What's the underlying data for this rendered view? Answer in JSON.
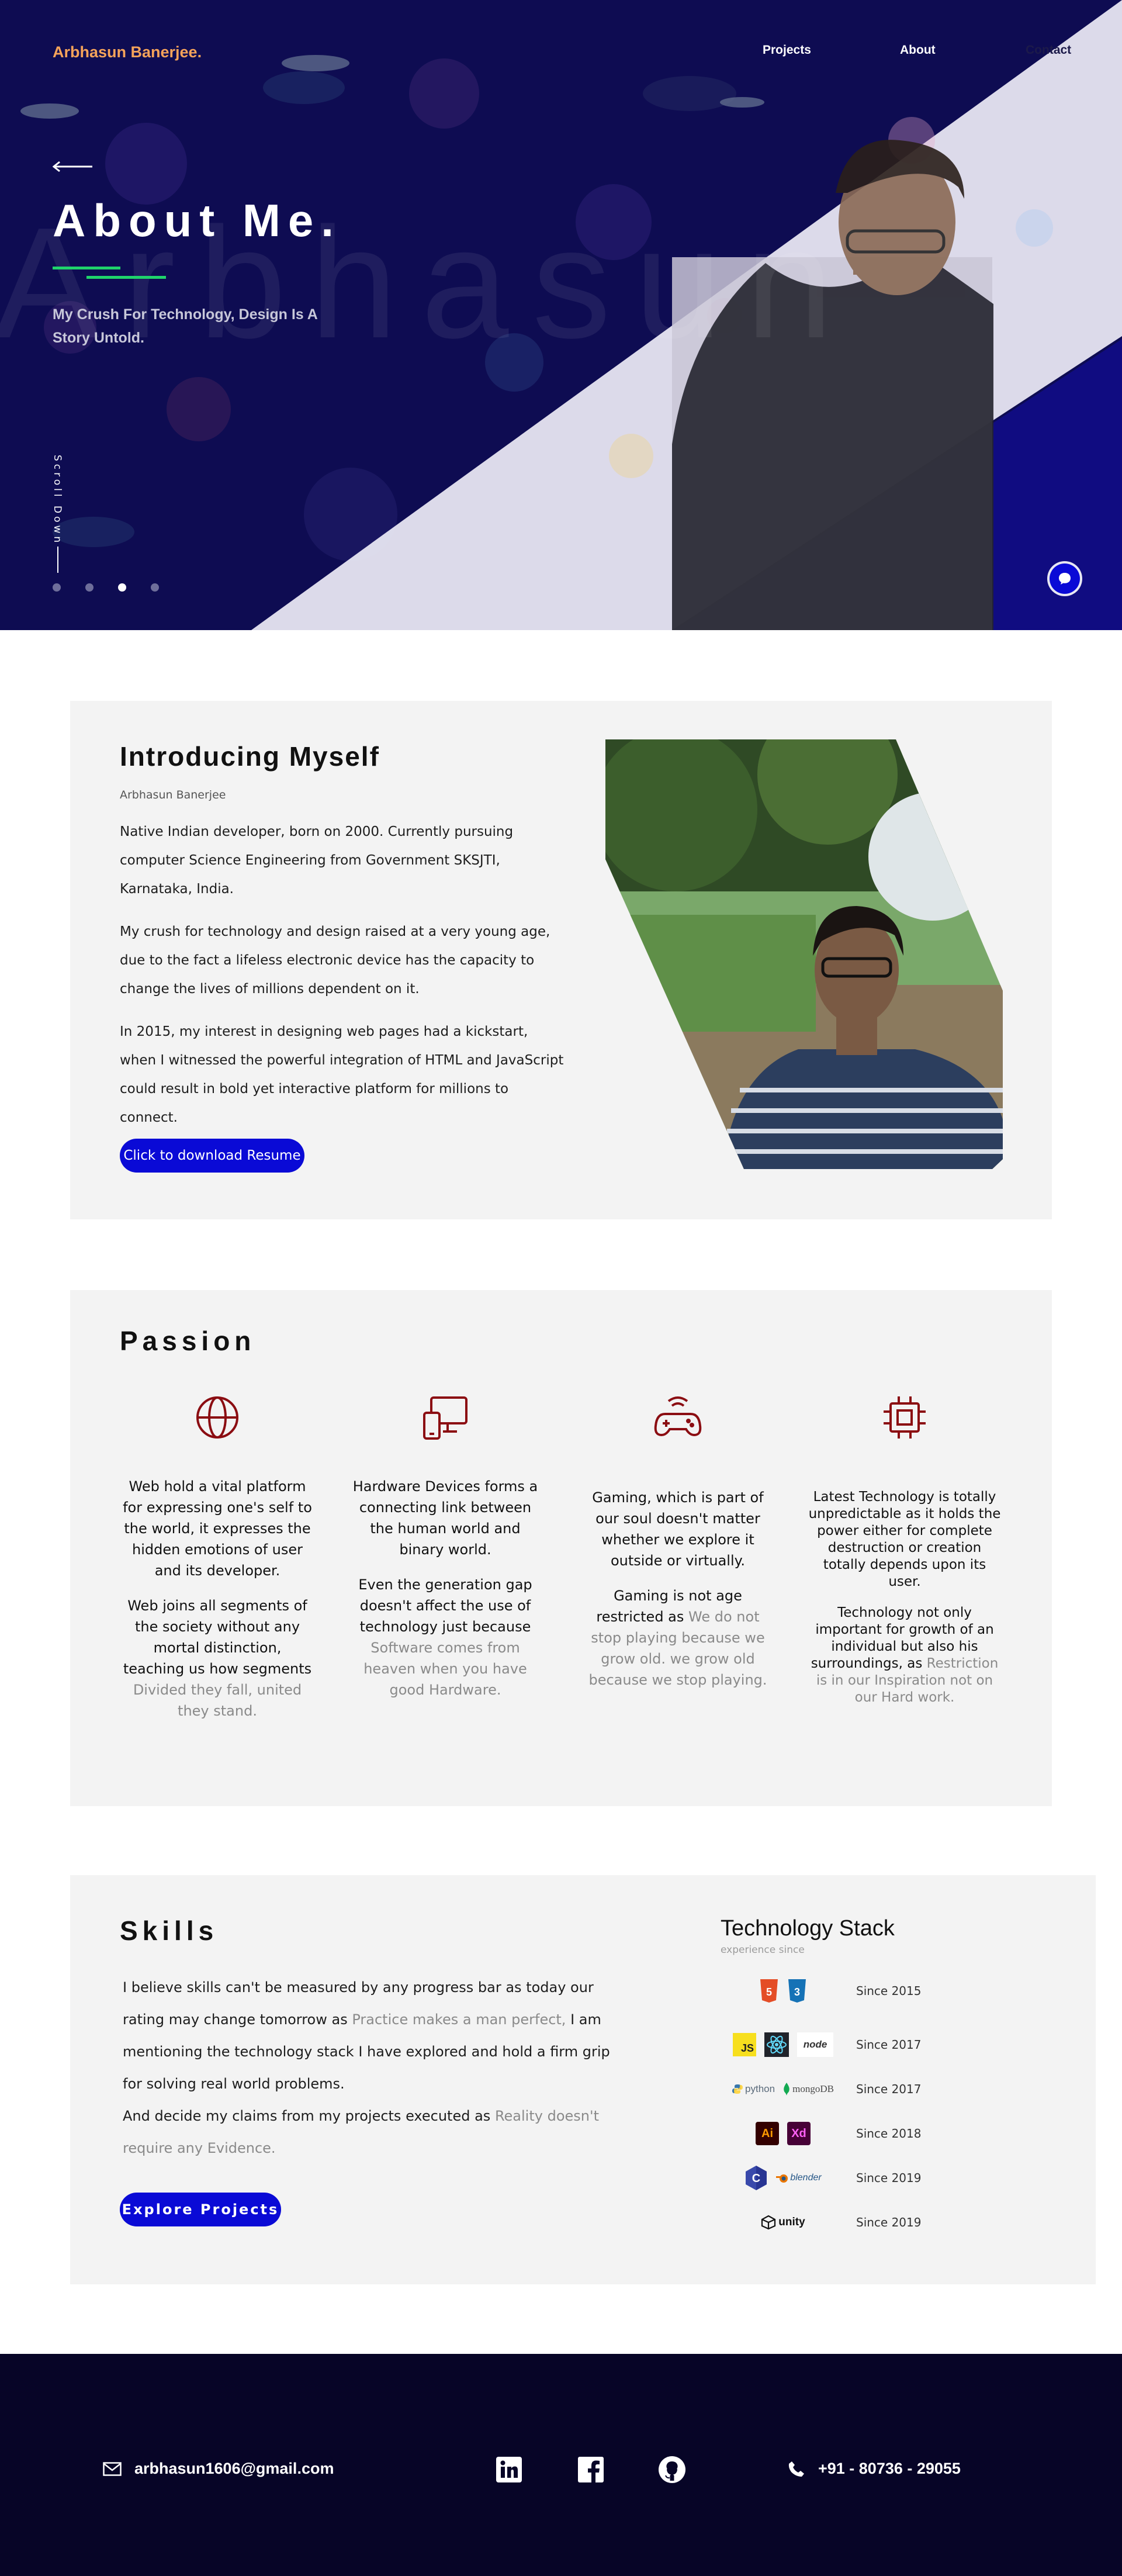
{
  "header": {
    "brand": "Arbhasun Banerjee.",
    "nav": [
      "Projects",
      "About",
      "Contact"
    ]
  },
  "hero": {
    "title": "About Me.",
    "subtitle": "My Crush For Technology, Design Is A Story Untold.",
    "watermark": "Arbhasun",
    "scroll_label": "Scroll Down",
    "slides": 4,
    "active_slide": 3,
    "accent_color": "#1fd46b"
  },
  "intro": {
    "title": "Introducing Myself",
    "name": "Arbhasun Banerjee",
    "paragraphs": [
      "Native Indian developer, born on 2000. Currently pursuing computer Science Engineering from Government SKSJTI, Karnataka, India.",
      "My crush for technology and design raised at a very young age, due to the fact a lifeless electronic device has the capacity to change the lives of millions dependent on it.",
      "In 2015, my interest in designing web pages had a kickstart, when I witnessed the powerful integration of HTML and JavaScript could result in bold yet interactive platform for millions to connect."
    ],
    "button": "Click to download Resume"
  },
  "passion": {
    "title": "Passion",
    "items": [
      {
        "icon": "globe-icon",
        "text1": "Web hold a vital platform for expressing one's self to the world, it expresses the hidden emotions of user and its developer.",
        "text2": "Web joins all segments of the society without any mortal distinction, teaching us how segments",
        "muted": "Divided they fall, united they stand."
      },
      {
        "icon": "devices-icon",
        "text1": "Hardware Devices forms a connecting link between the human world and binary world.",
        "text2": "Even the generation gap doesn't affect the use of technology just because",
        "muted": "Software comes from heaven when you have good Hardware."
      },
      {
        "icon": "gamepad-icon",
        "text1": "Gaming, which is part of our soul doesn't matter whether we explore it outside or virtually.",
        "text2": "Gaming is not age restricted as",
        "muted": "We do not stop playing because we grow old. we grow old because we stop playing."
      },
      {
        "icon": "chip-icon",
        "text1": "Latest Technology is totally unpredictable as it holds the power either for complete destruction or creation totally depends upon its user.",
        "text2": "Technology not only important for growth of an individual but also his surroundings, as",
        "muted": "Restriction is in our Inspiration not on our Hard work."
      }
    ],
    "icon_color": "#8b0d12"
  },
  "skills": {
    "title": "Skills",
    "p1_a": "I believe skills can't be measured by any progress bar as today our rating may change tomorrow as",
    "p1_muted": "Practice makes a man perfect,",
    "p1_b": "I am mentioning the technology stack I have explored and hold a firm grip for solving real world problems.",
    "p2_a": "And decide my claims from my projects executed as",
    "p2_muted": "Reality doesn't require any Evidence.",
    "button": "Explore Projects",
    "tech_title": "Technology Stack",
    "tech_subtitle": "experience since",
    "tech_rows": [
      {
        "labels": [
          "HTML5",
          "CSS3"
        ],
        "since": "Since 2015"
      },
      {
        "labels": [
          "JS",
          "React",
          "node"
        ],
        "since": "Since 2017"
      },
      {
        "labels": [
          "python",
          "mongoDB"
        ],
        "since": "Since 2017"
      },
      {
        "labels": [
          "Ai",
          "Xd"
        ],
        "since": "Since 2018"
      },
      {
        "labels": [
          "C",
          "blender"
        ],
        "since": "Since 2019"
      },
      {
        "labels": [
          "unity"
        ],
        "since": "Since 2019"
      }
    ]
  },
  "footer": {
    "email": "arbhasun1606@gmail.com",
    "phone": "+91 - 80736 - 29055",
    "social": [
      "linkedin-icon",
      "facebook-icon",
      "github-icon"
    ]
  },
  "colors": {
    "primary_button": "#0a0ad6",
    "hero_bg": "#0d0b4f",
    "brand": "#f5a35a",
    "footer_bg": "#070527"
  }
}
